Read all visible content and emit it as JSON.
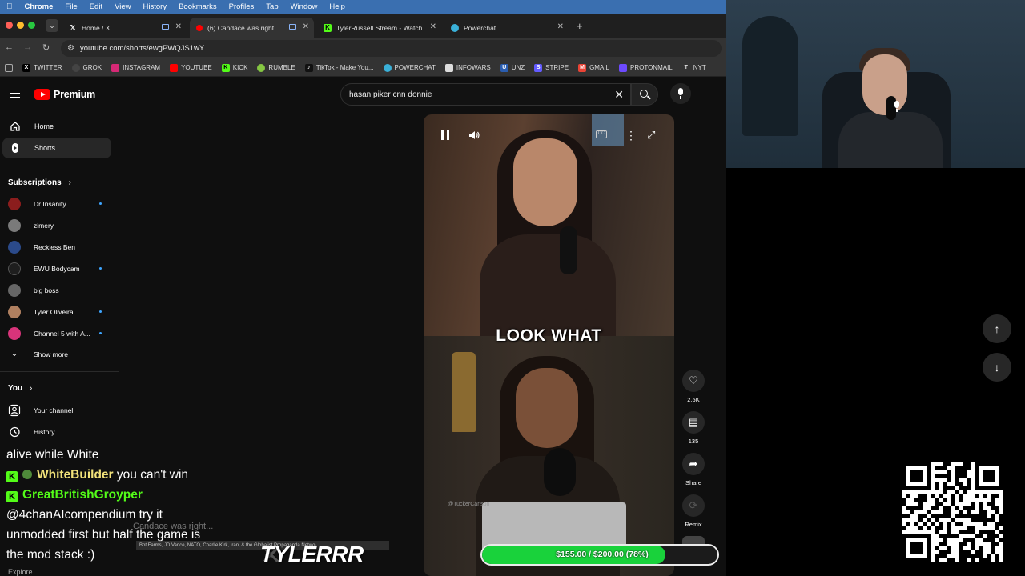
{
  "menubar": {
    "app": "Chrome",
    "items": [
      "File",
      "Edit",
      "View",
      "History",
      "Bookmarks",
      "Profiles",
      "Tab",
      "Window",
      "Help"
    ]
  },
  "tabs": [
    {
      "title": "Home / X",
      "favicon": "x-logo-icon",
      "active": false
    },
    {
      "title": "(6) Candace was right...",
      "favicon": "youtube-icon",
      "active": true
    },
    {
      "title": "TylerRussell Stream - Watch",
      "favicon": "kick-icon",
      "active": false
    },
    {
      "title": "Powerchat",
      "favicon": "powerchat-icon",
      "active": false
    }
  ],
  "address": {
    "url": "youtube.com/shorts/ewgPWQJS1wY"
  },
  "bookmarks": [
    {
      "label": "TWITTER",
      "icon": "x-logo-icon",
      "color": "#000000"
    },
    {
      "label": "GROK",
      "icon": "grok-icon",
      "color": "#444444"
    },
    {
      "label": "INSTAGRAM",
      "icon": "instagram-icon",
      "color": "#d62976"
    },
    {
      "label": "YOUTUBE",
      "icon": "youtube-icon",
      "color": "#ff0000"
    },
    {
      "label": "KICK",
      "icon": "kick-icon",
      "color": "#53fc18"
    },
    {
      "label": "RUMBLE",
      "icon": "rumble-icon",
      "color": "#85c742"
    },
    {
      "label": "TikTok - Make You...",
      "icon": "tiktok-icon",
      "color": "#111111"
    },
    {
      "label": "POWERCHAT",
      "icon": "powerchat-icon",
      "color": "#3ab0d8"
    },
    {
      "label": "INFOWARS",
      "icon": "infowars-icon",
      "color": "#dddddd"
    },
    {
      "label": "UNZ",
      "icon": "unz-icon",
      "color": "#2a5db0"
    },
    {
      "label": "STRIPE",
      "icon": "stripe-icon",
      "color": "#635bff"
    },
    {
      "label": "GMAIL",
      "icon": "gmail-icon",
      "color": "#ea4335"
    },
    {
      "label": "PROTONMAIL",
      "icon": "proton-icon",
      "color": "#6d4aff"
    },
    {
      "label": "NYT",
      "icon": "nyt-icon",
      "color": "#dddddd"
    }
  ],
  "youtube": {
    "logo_word": "Premium",
    "search_query": "hasan piker cnn donnie",
    "nav": [
      {
        "label": "Home",
        "icon": "home-icon"
      },
      {
        "label": "Shorts",
        "icon": "shorts-icon"
      }
    ],
    "subscriptions_heading": "Subscriptions",
    "subscriptions": [
      {
        "name": "Dr Insanity",
        "new": true,
        "color": "#8b1d1d"
      },
      {
        "name": "zimery",
        "new": false,
        "color": "#7a7a7a"
      },
      {
        "name": "Reckless Ben",
        "new": false,
        "color": "#2b4a8a"
      },
      {
        "name": "EWU Bodycam",
        "new": true,
        "color": "#1e1e1e"
      },
      {
        "name": "big boss",
        "new": false,
        "color": "#666666"
      },
      {
        "name": "Tyler Oliveira",
        "new": true,
        "color": "#b08060"
      },
      {
        "name": "Channel 5 with A...",
        "new": true,
        "color": "#d8347a"
      }
    ],
    "show_more": "Show more",
    "you_heading": "You",
    "you_items": [
      {
        "label": "Your channel",
        "icon": "person-icon"
      },
      {
        "label": "History",
        "icon": "history-icon"
      }
    ],
    "explore": "Explore"
  },
  "short": {
    "caption": "LOOK WHAT",
    "handle": "@TuckerCarlson",
    "title": "Candace was right...",
    "likes": "2.5K",
    "comments": "135",
    "share_label": "Share",
    "remix_label": "Remix"
  },
  "chat": {
    "line1": "alive while White",
    "user1": "WhiteBuilder",
    "msg1": "you can't win",
    "user2": "GreatBritishGroyper",
    "line3": "@4chanAIcompendium try it",
    "line4": "unmodded first but half the game is",
    "line5": "the mod stack :)"
  },
  "overlay": {
    "watermark": "TYLERRR",
    "ticker": "Bot Farms, JD Vance, NATO, Charlie Kirk, Iran, & the Globalist Propaganda Netwo..."
  },
  "goal": {
    "text": "$155.00 / $200.00 (78%)",
    "progress": 0.78
  }
}
